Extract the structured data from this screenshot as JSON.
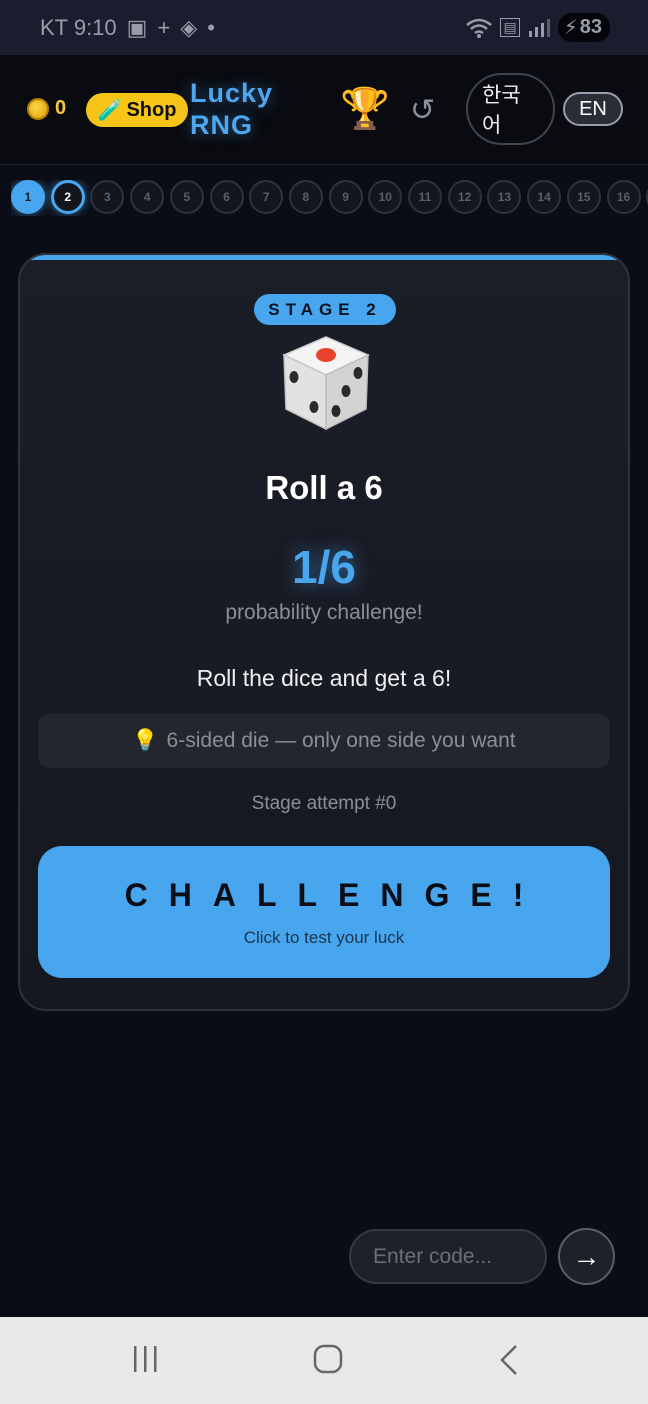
{
  "status_bar": {
    "carrier_time": "KT 9:10",
    "battery": "83"
  },
  "header": {
    "coins": "0",
    "shop_label": "Shop",
    "brand_line1": "Lucky",
    "brand_line2": "RNG",
    "lang_ko_label": "한국어",
    "lang_en_label": "EN"
  },
  "stages": {
    "labels": [
      "1",
      "2",
      "3",
      "4",
      "5",
      "6",
      "7",
      "8",
      "9",
      "10",
      "11",
      "12",
      "13",
      "14",
      "15",
      "16"
    ],
    "completed": 1,
    "current": 2
  },
  "card": {
    "stage_label": "STAGE 2",
    "title": "Roll a 6",
    "probability": "1/6",
    "probability_caption": "probability challenge!",
    "description": "Roll the dice and get a 6!",
    "hint": "6-sided die — only one side you want",
    "attempt": "Stage attempt #0",
    "button_label": "CHALLENGE!",
    "button_sub": "Click to test your luck"
  },
  "code_entry": {
    "placeholder": "Enter code...",
    "submit_icon": "→"
  },
  "icons": {
    "coin": "coin-icon",
    "shop": "test-tube-icon",
    "trophy": "trophy-icon",
    "reset": "reset-icon",
    "hint": "lightbulb-icon",
    "dice": "dice-icon"
  },
  "colors": {
    "accent": "#47a6ee",
    "shop": "#f7c518",
    "background": "#0b0d16",
    "card": "#1b1d27"
  }
}
